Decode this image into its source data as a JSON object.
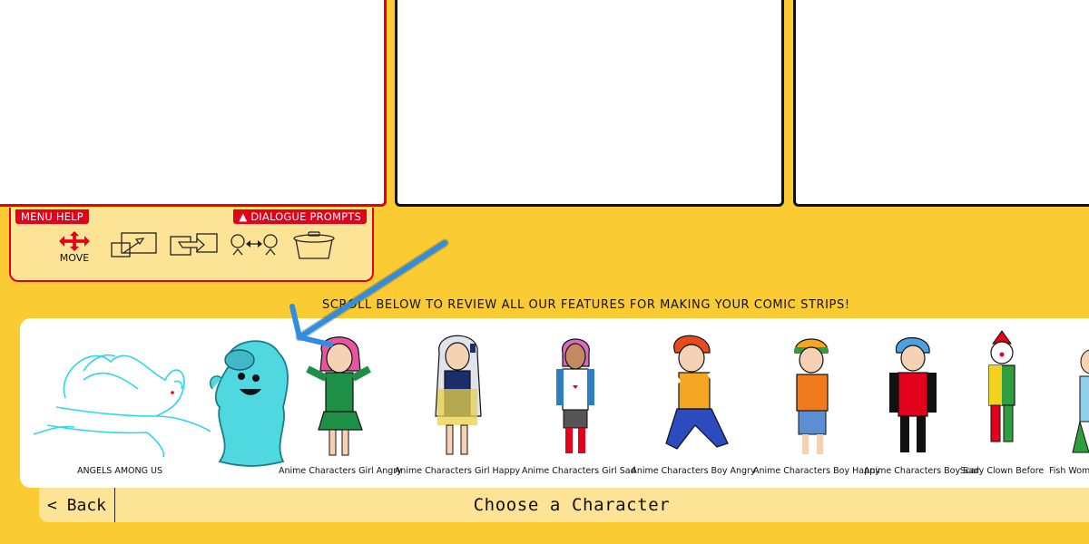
{
  "toolbox": {
    "menu_help": "MENU HELP",
    "dialogue_prompts": "▲ DIALOGUE PROMPTS",
    "tools": [
      {
        "icon": "move-arrows-icon",
        "label": "MOVE"
      },
      {
        "icon": "resize-icon",
        "label": ""
      },
      {
        "icon": "flip-icon",
        "label": ""
      },
      {
        "icon": "swap-characters-icon",
        "label": ""
      },
      {
        "icon": "trash-can-icon",
        "label": ""
      }
    ]
  },
  "callout": "SCROLL BELOW TO REVIEW ALL OUR FEATURES FOR MAKING YOUR COMIC STRIPS!",
  "characters": [
    {
      "label": "ANGELS AMONG US",
      "icon": "angel-outline-icon"
    },
    {
      "label": "",
      "icon": "ghost-boo-icon"
    },
    {
      "label": "Anime Characters Girl Angry",
      "icon": "anime-girl-angry-icon"
    },
    {
      "label": "Anime Characters Girl Happy",
      "icon": "anime-girl-happy-icon"
    },
    {
      "label": "Anime Characters Girl Sad",
      "icon": "anime-girl-sad-icon"
    },
    {
      "label": "Anime Characters Boy Angry",
      "icon": "anime-boy-angry-icon"
    },
    {
      "label": "Anime Characters Boy Happy",
      "icon": "anime-boy-happy-icon"
    },
    {
      "label": "Anime Characters Boy Sad",
      "icon": "anime-boy-sad-icon"
    },
    {
      "label": "Scary Clown Before",
      "icon": "scary-clown-icon"
    },
    {
      "label": "Fish Wom",
      "icon": "fish-woman-icon"
    }
  ],
  "bottom_bar": {
    "back": "< Back",
    "title": "Choose a Character"
  },
  "colors": {
    "background": "#fbcb33",
    "accent_red": "#e3001b",
    "panel_tray": "#fde396",
    "annotation_arrow": "#2f8ee0"
  }
}
